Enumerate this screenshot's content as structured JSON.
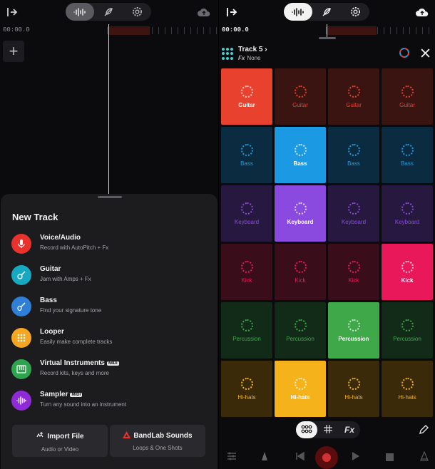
{
  "left_panel": {
    "time": "00:00.0",
    "add_label": "+",
    "sheet": {
      "title": "New Track",
      "items": [
        {
          "title": "Voice/Audio",
          "subtitle": "Record with AutoPitch + Fx",
          "color": "#e8322b",
          "icon": "microphone-icon",
          "midi": ""
        },
        {
          "title": "Guitar",
          "subtitle": "Jam with Amps + Fx",
          "color": "#17a8c2",
          "icon": "guitar-icon",
          "midi": ""
        },
        {
          "title": "Bass",
          "subtitle": "Find your signature tone",
          "color": "#2f7ed8",
          "icon": "bass-icon",
          "midi": ""
        },
        {
          "title": "Looper",
          "subtitle": "Easily make complete tracks",
          "color": "#f5a623",
          "icon": "looper-icon",
          "midi": ""
        },
        {
          "title": "Virtual Instruments",
          "subtitle": "Record kits, keys and more",
          "color": "#2ea44f",
          "icon": "keyboard-icon",
          "midi": "MIDI"
        },
        {
          "title": "Sampler",
          "subtitle": "Turn any sound into an instrument",
          "color": "#8e2bd6",
          "icon": "waveform-icon",
          "midi": "MIDI"
        }
      ],
      "import": {
        "title": "Import File",
        "subtitle": "Audio or Video"
      },
      "bandlab": {
        "title": "BandLab Sounds",
        "subtitle": "Loops & One Shots"
      }
    }
  },
  "right_panel": {
    "time": "00:00.0",
    "track": {
      "name": "Track 5",
      "chevron": "›",
      "fx_prefix": "Fx",
      "fx_value": "None"
    },
    "bottom_tabs": [
      {
        "name": "pads",
        "label": "",
        "active": true
      },
      {
        "name": "grid",
        "label": "",
        "active": false
      },
      {
        "name": "fx",
        "label": "Fx",
        "active": false
      }
    ],
    "pads": [
      {
        "label": "Guitar",
        "color": "#e8412d",
        "active": true
      },
      {
        "label": "Guitar",
        "color": "#3a1410",
        "active": false
      },
      {
        "label": "Guitar",
        "color": "#3a1410",
        "active": false
      },
      {
        "label": "Guitar",
        "color": "#3a1410",
        "active": false
      },
      {
        "label": "Bass",
        "color": "#0b2c40",
        "active": false
      },
      {
        "label": "Bass",
        "color": "#1b9ae3",
        "active": true
      },
      {
        "label": "Bass",
        "color": "#0b2c40",
        "active": false
      },
      {
        "label": "Bass",
        "color": "#0b2c40",
        "active": false
      },
      {
        "label": "Keyboard",
        "color": "#27183f",
        "active": false
      },
      {
        "label": "Keyboard",
        "color": "#8a4ae0",
        "active": true
      },
      {
        "label": "Keyboard",
        "color": "#27183f",
        "active": false
      },
      {
        "label": "Keyboard",
        "color": "#27183f",
        "active": false
      },
      {
        "label": "Kick",
        "color": "#3a0d1a",
        "active": false
      },
      {
        "label": "Kick",
        "color": "#3a0d1a",
        "active": false
      },
      {
        "label": "Kick",
        "color": "#3a0d1a",
        "active": false
      },
      {
        "label": "Kick",
        "color": "#e8185b",
        "active": true
      },
      {
        "label": "Percussion",
        "color": "#122b18",
        "active": false
      },
      {
        "label": "Percussion",
        "color": "#122b18",
        "active": false
      },
      {
        "label": "Percussion",
        "color": "#3fa94a",
        "active": true
      },
      {
        "label": "Percussion",
        "color": "#122b18",
        "active": false
      },
      {
        "label": "Hi-hats",
        "color": "#3b2a09",
        "active": false
      },
      {
        "label": "Hi-hats",
        "color": "#f5b21a",
        "active": true
      },
      {
        "label": "Hi-hats",
        "color": "#3b2a09",
        "active": false
      },
      {
        "label": "Hi-hats",
        "color": "#3b2a09",
        "active": false
      }
    ],
    "accent_colors": {
      "Guitar": "#e8412d",
      "Bass": "#1b9ae3",
      "Keyboard": "#8a4ae0",
      "Kick": "#e8185b",
      "Percussion": "#3fa94a",
      "Hi-hats": "#f5b21a"
    }
  }
}
